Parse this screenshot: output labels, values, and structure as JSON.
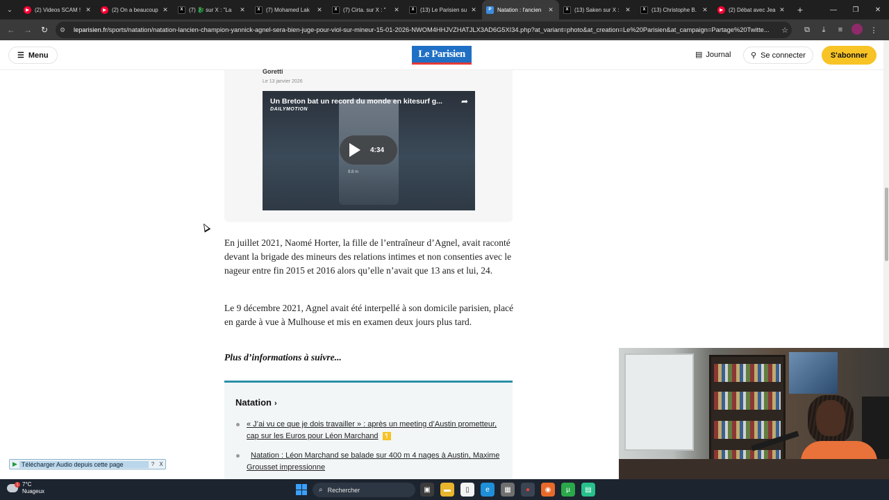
{
  "browser": {
    "tabs": [
      {
        "label": "(2) Videos SCAM !",
        "favicon": "youtube-icon"
      },
      {
        "label": "(2) On a beaucoup",
        "favicon": "youtube-icon"
      },
      {
        "label": "(7) 🐉 sur X : \"La",
        "favicon": "x-icon"
      },
      {
        "label": "(7) Mohamed Lak",
        "favicon": "x-icon"
      },
      {
        "label": "(7) Cirta. sur X : \"",
        "favicon": "x-icon"
      },
      {
        "label": "(13) Le Parisien su",
        "favicon": "x-icon"
      },
      {
        "label": "Natation : l'ancien",
        "favicon": "leparisien-icon",
        "active": true
      },
      {
        "label": "(13) Saken sur X :",
        "favicon": "x-icon"
      },
      {
        "label": "(13) Christophe B.",
        "favicon": "x-icon"
      },
      {
        "label": "(2) Débat avec Jea",
        "favicon": "youtube-icon"
      }
    ],
    "url_domain": "leparisien.fr",
    "url_path": "/sports/natation/natation-lancien-champion-yannick-agnel-sera-bien-juge-pour-viol-sur-mineur-15-01-2026-NWOM4HHJVZHATJLX3AD6G5XI34.php?at_variant=photo&at_creation=Le%20Parisien&at_campaign=Partage%20Twitte..."
  },
  "header": {
    "menu_label": "Menu",
    "logo_text": "Le Parisien",
    "journal_label": "Journal",
    "connect_label": "Se connecter",
    "subscribe_label": "S'abonner"
  },
  "video": {
    "author": "Goretti",
    "date": "Le 13 janvier 2026",
    "title": "Un Breton bat un record du monde en kitesurf g...",
    "brand": "DAILYMOTION",
    "duration": "4:34",
    "overlay_text": "9.8 m"
  },
  "article": {
    "paragraph_1": "En juillet 2021, Naomé Horter, la fille de l’entraîneur d’Agnel, avait raconté devant la brigade des mineurs des relations intimes et non consenties avec le nageur entre fin 2015 et 2016 alors qu’elle n’avait que 13 ans et lui, 24.",
    "paragraph_2": "Le 9 décembre 2021, Agnel avait été interpellé à son domicile parisien, placé en garde à vue à Mulhouse et mis en examen deux jours plus tard.",
    "more_info": "Plus d’informations à suivre..."
  },
  "related": {
    "heading": "Natation",
    "items": [
      {
        "text": "« J’ai vu ce que je dois travailler » : après un meeting d’Austin prometteur, cap sur les Euros pour Léon Marchand",
        "badge": "¶"
      },
      {
        "text": "Natation : Léon Marchand se balade sur 400 m 4 nages à Austin, Maxime Grousset impressionne"
      }
    ]
  },
  "extension_bar": {
    "label": "Télécharger Audio depuis cette page",
    "help": "?",
    "close": "X"
  },
  "taskbar": {
    "temperature": "7°C",
    "weather": "Nuageux",
    "weather_badge": "1",
    "search_label": "Rechercher"
  },
  "colors": {
    "brand_blue": "#1f6fc5",
    "subscribe_yellow": "#f7c325",
    "related_accent": "#2a8fa6"
  }
}
